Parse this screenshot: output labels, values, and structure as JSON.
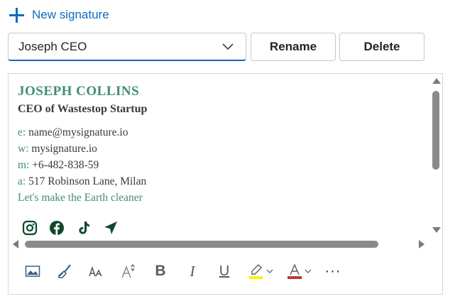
{
  "header": {
    "new_signature_label": "New signature"
  },
  "signature_select": {
    "selected": "Joseph CEO"
  },
  "buttons": {
    "rename": "Rename",
    "delete": "Delete"
  },
  "signature": {
    "name": "JOSEPH COLLINS",
    "title": "CEO of Wastestop Startup",
    "email_label": "e:",
    "email": "name@mysignature.io",
    "web_label": "w:",
    "web": "mysignature.io",
    "mobile_label": "m:",
    "mobile": "+6-482-838-59",
    "address_label": "a:",
    "address": "517 Robinson Lane, Milan",
    "slogan": "Let's make the Earth cleaner"
  },
  "social_icons": [
    "instagram-icon",
    "facebook-icon",
    "tiktok-icon",
    "location-arrow-icon"
  ],
  "toolbar": {
    "italic": "I",
    "bold": "B",
    "underline": "U",
    "more": "···"
  },
  "colors": {
    "accent": "#0f6cbd",
    "brand_green": "#3f8f6c",
    "icon_green": "#0e4a2c",
    "highlight": "#fff200",
    "font_color": "#c0392b"
  }
}
